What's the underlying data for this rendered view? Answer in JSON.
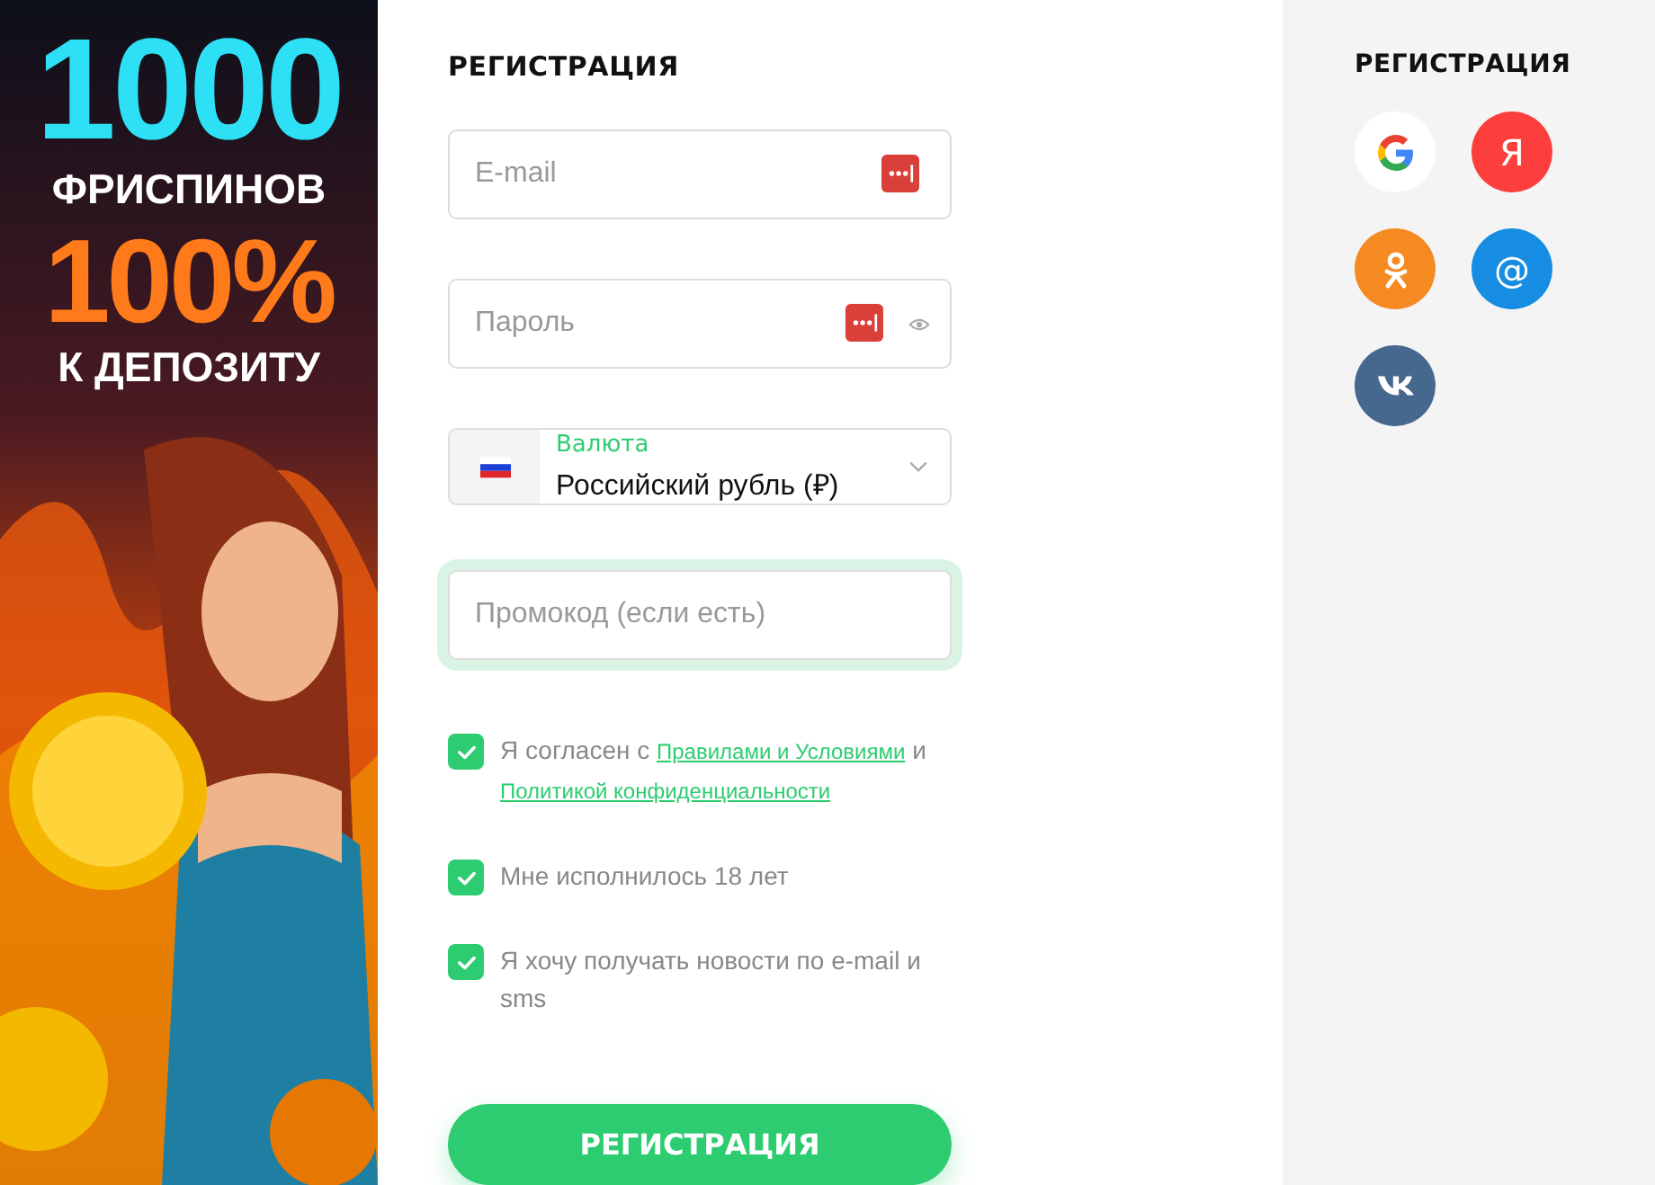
{
  "banner": {
    "kind": "picture",
    "line_1": "1000",
    "line_2": "ФРИСПИНОВ",
    "line_3": "100%",
    "line_4": "К ДЕПОЗИТУ"
  },
  "form": {
    "title": "РЕГИСТРАЦИЯ",
    "fields": [
      {
        "kind": "text",
        "placeholder": "E-mail",
        "focused": false
      },
      {
        "kind": "password",
        "placeholder": "Пароль",
        "focused": false
      },
      {
        "kind": "currency",
        "label": "Валюта",
        "value": "Российский рубль (₽)",
        "focused": false
      },
      {
        "kind": "text",
        "placeholder": "Промокод (если есть)",
        "focused": true
      }
    ],
    "checkboxes": [
      {
        "parts": [
          {
            "text": "Я согласен с ",
            "link": false
          },
          {
            "text": "Правилами и Условиями",
            "link": true
          },
          {
            "text": " и ",
            "link": false
          },
          {
            "text": "Политикой конфиденциальности",
            "link": true
          }
        ],
        "checked": true
      },
      {
        "parts": [
          {
            "text": "Мне исполнилось 18 лет",
            "link": false
          }
        ],
        "checked": true
      },
      {
        "parts": [
          {
            "text": "Я хочу получать новости по e-mail и sms",
            "link": false
          }
        ],
        "checked": true
      }
    ],
    "submit": "РЕГИСТРАЦИЯ"
  },
  "social": {
    "title": "РЕГИСТРАЦИЯ",
    "buttons": [
      {
        "kind": "google",
        "color": "#ffffff"
      },
      {
        "kind": "glyph",
        "glyph": "Я",
        "color": "#fc3f3d"
      },
      {
        "kind": "ok",
        "color": "#f68a22"
      },
      {
        "kind": "glyph",
        "glyph": "@",
        "color": "#168de2"
      },
      {
        "kind": "vk",
        "color": "#46688f"
      }
    ]
  }
}
